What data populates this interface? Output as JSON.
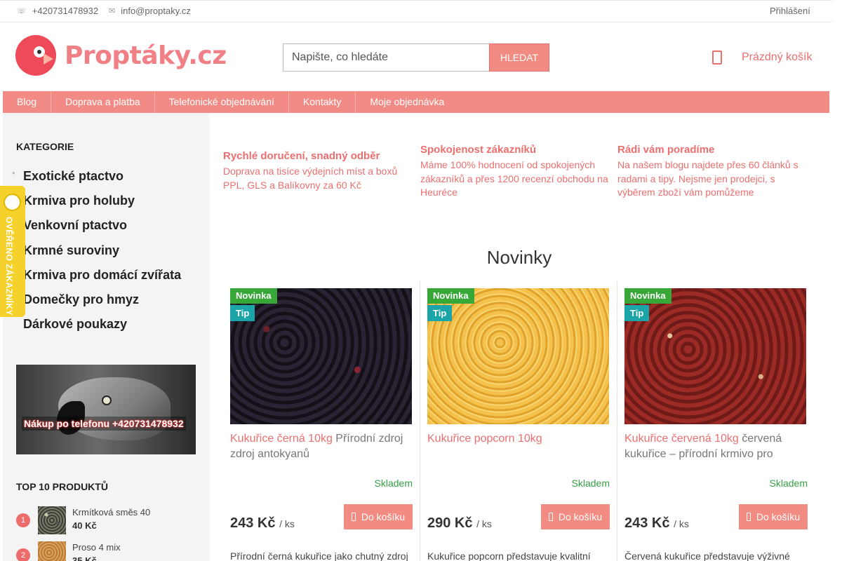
{
  "topbar": {
    "phone": "+420731478932",
    "email": "info@proptaky.cz",
    "login": "Přihlášení"
  },
  "logo": {
    "text": "Proptáky.cz"
  },
  "search": {
    "placeholder": "Napište, co hledáte",
    "button": "HLEDAT"
  },
  "cart": {
    "label": "Prázdný košík"
  },
  "nav": [
    "Blog",
    "Doprava a platba",
    "Telefonické objednávání",
    "Kontakty",
    "Moje objednávka"
  ],
  "sidebar": {
    "heading": "KATEGORIE",
    "categories": [
      "Exotické ptactvo",
      "Krmiva pro holuby",
      "Venkovní ptactvo",
      "Krmné suroviny",
      "Krmiva pro domácí zvířata",
      "Domečky pro hmyz",
      "Dárkové poukazy"
    ],
    "banner_text": "Nákup po telefonu +420731478932",
    "top10_heading": "TOP 10 PRODUKTŮ",
    "top10": [
      {
        "rank": "1",
        "name": "Krmítková směs 40",
        "price": "40 Kč"
      },
      {
        "rank": "2",
        "name": "Proso 4 mix",
        "price": "35 Kč"
      }
    ]
  },
  "side_badge": {
    "text": "OVĚŘENO ZÁKAZNÍKY",
    "color": "#f5d12c"
  },
  "usps": [
    {
      "title": "Rychlé doručení, snadný odběr",
      "text": "Doprava na tisíce výdejních míst a boxů PPL, GLS a Balíkovny za 60 Kč"
    },
    {
      "title": "Spokojenost zákazníků",
      "text": "Máme 100% hodnocení od spokojených zákazníků a přes 1200 recenzí obchodu na Heuréce"
    },
    {
      "title": "Rádi vám poradíme",
      "text": "Na našem blogu najdete přes 60 článků s radami a tipy. Nejsme jen prodejci, s výběrem zboží vám pomůžeme"
    }
  ],
  "section_title": "Novinky",
  "products": [
    {
      "flag_new": "Novinka",
      "flag_tip": "Tip",
      "title": "Kukuřice černá 10kg",
      "subtitle": " Přírodní zdroj zdroj antokyanů",
      "stock": "Skladem",
      "price": "243 Kč",
      "unit": "/ ks",
      "buy": "Do košíku",
      "desc": "Přírodní černá kukuřice jako chutný zdroj"
    },
    {
      "flag_new": "Novinka",
      "flag_tip": "Tip",
      "title": "Kukuřice popcorn 10kg",
      "subtitle": "",
      "stock": "Skladem",
      "price": "290 Kč",
      "unit": "/ ks",
      "buy": "Do košíku",
      "desc": "Kukuřice popcorn představuje kvalitní"
    },
    {
      "flag_new": "Novinka",
      "flag_tip": "Tip",
      "title": "Kukuřice červená 10kg",
      "subtitle": " červená kukuřice – přírodní krmivo pro",
      "stock": "Skladem",
      "price": "243 Kč",
      "unit": "/ ks",
      "buy": "Do košíku",
      "desc": "Červená kukuřice představuje výživné"
    }
  ],
  "colors": {
    "accent": "#f28b86",
    "link": "#ec6f6f",
    "new": "#37a838",
    "tip": "#1ba5a8",
    "stock": "#35a044"
  }
}
